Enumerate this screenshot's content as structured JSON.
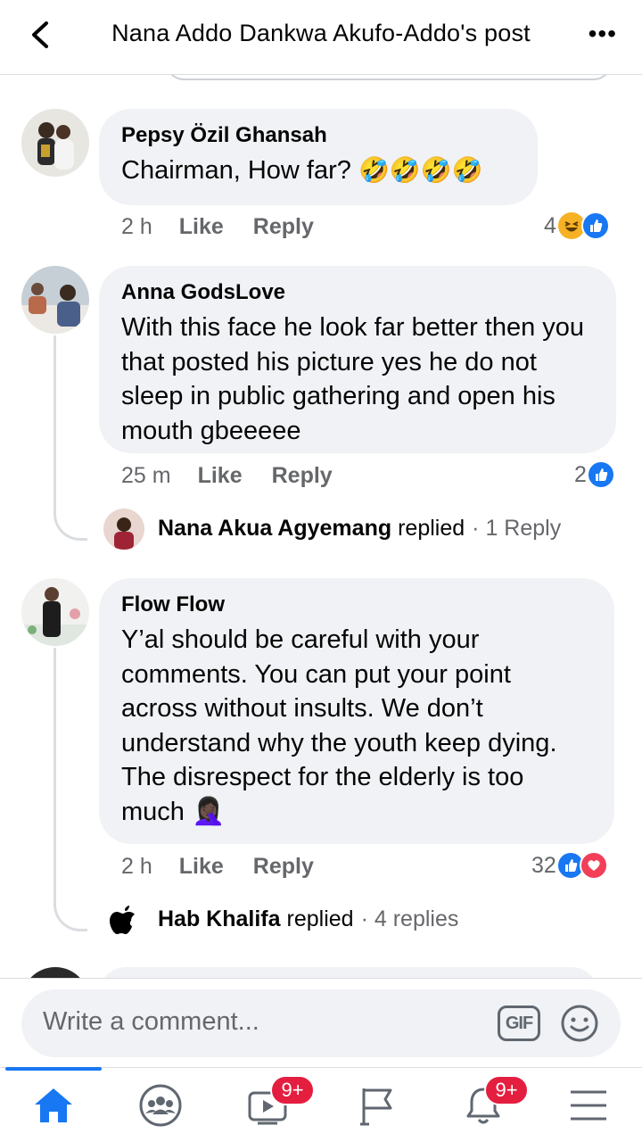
{
  "header": {
    "title": "Nana Addo Dankwa Akufo-Addo's post",
    "back_icon": "chevron-left-icon",
    "more_label": "•••"
  },
  "comments": [
    {
      "author": "Pepsy Özil Ghansah",
      "text": "Chairman, How far?",
      "emoji": "🤣🤣🤣🤣",
      "time": "2 h",
      "like_label": "Like",
      "reply_label": "Reply",
      "reaction_count": "4",
      "reactions": [
        "haha-icon",
        "like-icon"
      ]
    },
    {
      "author": "Anna GodsLove",
      "text": "With this face he look far better then you that posted his picture yes he do not sleep in public gathering and open his mouth gbeeeee",
      "time": "25 m",
      "like_label": "Like",
      "reply_label": "Reply",
      "reaction_count": "2",
      "reactions": [
        "like-icon"
      ],
      "reply_summary": {
        "name": "Nana Akua Agyemang",
        "verb": "replied",
        "count": "· 1 Reply"
      }
    },
    {
      "author": "Flow Flow",
      "text": "Y’al should be careful with your comments. You can put your point across without insults. We don’t understand why the youth keep dying. The disrespect for the elderly is too much",
      "emoji": "🤦🏿‍♀️",
      "time": "2 h",
      "like_label": "Like",
      "reply_label": "Reply",
      "reaction_count": "32",
      "reactions": [
        "like-icon",
        "love-icon"
      ],
      "reply_summary": {
        "name": "Hab Khalifa",
        "verb": "replied",
        "count": "· 4 replies"
      }
    }
  ],
  "composer": {
    "placeholder": "Write a comment...",
    "gif_label": "GIF",
    "emoji_icon": "smiley-icon"
  },
  "tabbar": {
    "tabs": [
      "home-icon",
      "groups-icon",
      "watch-icon",
      "pages-icon",
      "notifications-icon",
      "menu-icon"
    ],
    "watch_badge": "9+",
    "notifications_badge": "9+"
  },
  "colors": {
    "accent": "#1877f2",
    "bubble": "#f0f2f5",
    "meta": "#65676b",
    "badge": "#e41e3f",
    "love": "#f33e58",
    "haha": "#f7b125"
  }
}
